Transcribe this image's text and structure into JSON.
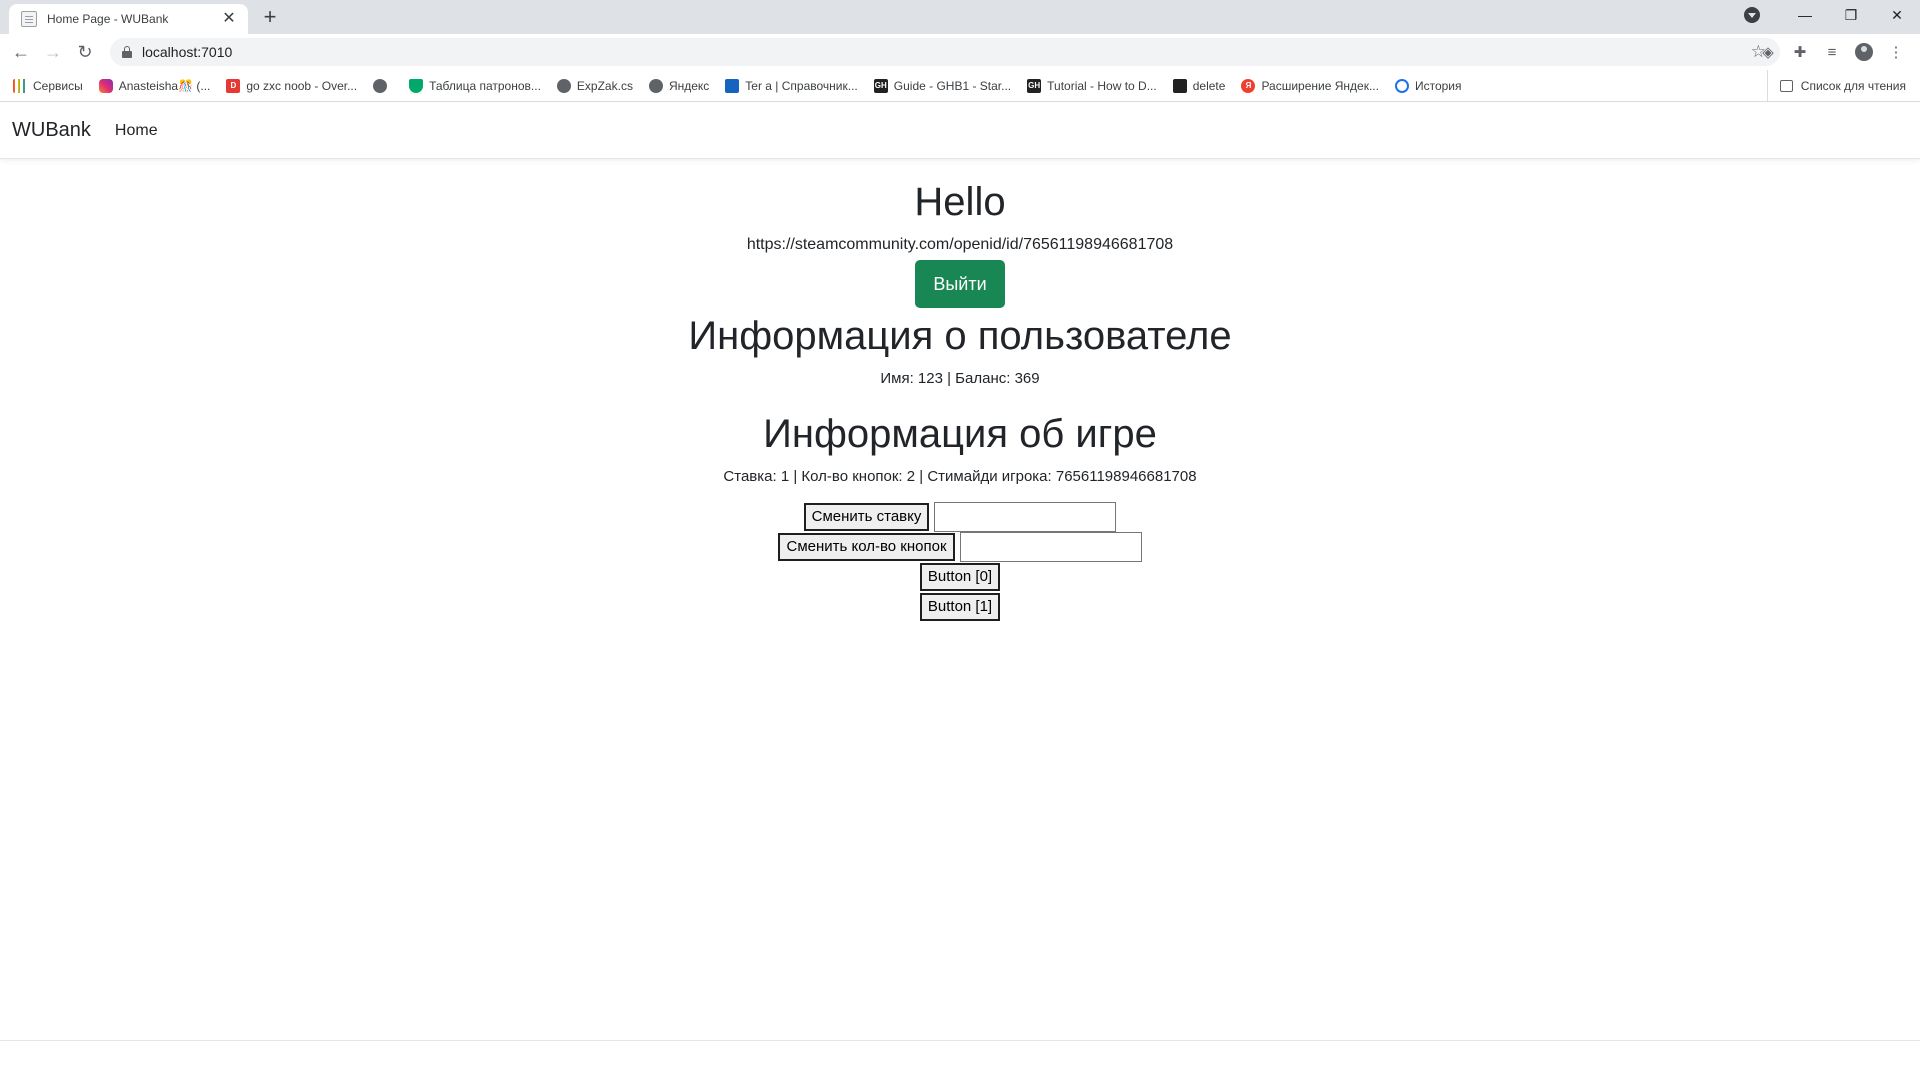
{
  "browser": {
    "tab_title": "Home Page - WUBank",
    "url": "localhost:7010",
    "bookmarks": [
      {
        "label": "Сервисы",
        "icon": "apps-icon"
      },
      {
        "label": "Anasteisha🎊 (...",
        "icon": "instagram-icon"
      },
      {
        "label": "go zxc noob - Over...",
        "icon": "d-icon"
      },
      {
        "label": "",
        "icon": "globe-icon"
      },
      {
        "label": "Таблица патронов...",
        "icon": "tree-icon"
      },
      {
        "label": "ExpZak.cs",
        "icon": "globe-icon"
      },
      {
        "label": "Яндекс",
        "icon": "globe-icon"
      },
      {
        "label": "Ter a | Справочник...",
        "icon": "bookmark-icon"
      },
      {
        "label": "Guide - GHB1 - Star...",
        "icon": "gh-icon"
      },
      {
        "label": "Tutorial - How to D...",
        "icon": "gh-icon"
      },
      {
        "label": "delete",
        "icon": "folder-icon"
      },
      {
        "label": "Расширение Яндек...",
        "icon": "yandex-icon"
      },
      {
        "label": "История",
        "icon": "history-icon"
      }
    ],
    "reading_list": "Список для чтения"
  },
  "site_nav": {
    "brand": "WUBank",
    "home": "Home"
  },
  "main": {
    "hello": "Hello",
    "openid": "https://steamcommunity.com/openid/id/76561198946681708",
    "logout_button": "Выйти",
    "user_heading": "Информация о пользователе",
    "user_info": "Имя: 123 | Баланс: 369",
    "game_heading": "Информация об игре",
    "game_info": "Ставка: 1 | Кол-во кнопок: 2 | Стимайди игрока: 76561198946681708",
    "change_bet_button": "Сменить ставку",
    "change_buttons_button": "Сменить кол-во кнопок",
    "bet_input_value": "",
    "buttons_input_value": "",
    "game_buttons": [
      "Button [0]",
      "Button [1]"
    ]
  },
  "colors": {
    "logout_button": "#198754",
    "text": "#212529"
  }
}
